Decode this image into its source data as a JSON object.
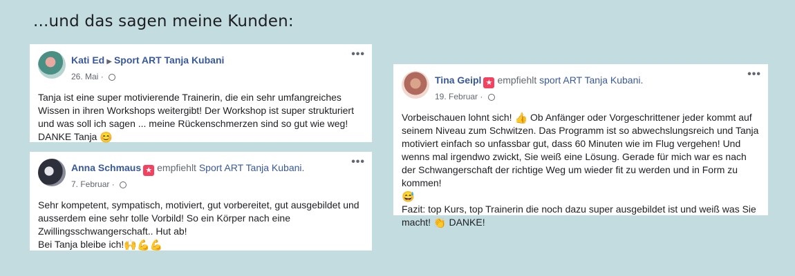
{
  "heading": "...und das sagen meine Kunden:",
  "reviews": [
    {
      "author": "Kati Ed",
      "arrow": "▶",
      "page": "Sport ART Tanja Kubani",
      "date": "26. Mai",
      "more": "•••",
      "text": "Tanja ist eine super motivierende Trainerin, die ein sehr umfangreiches Wissen in ihren Workshops weitergibt! Der Workshop ist super strukturiert und was soll ich sagen ... meine Rückenschmerzen sind so gut wie weg! DANKE Tanja",
      "emoji": "😊"
    },
    {
      "author": "Anna Schmaus",
      "badge_label": "empfiehlt",
      "page": "Sport ART Tanja Kubani.",
      "date": "7. Februar",
      "more": "•••",
      "text_lines": [
        "Sehr kompetent, sympatisch, motiviert, gut vorbereitet, gut ausgebildet und ausserdem eine sehr tolle Vorbild! So ein Körper nach eine Zwillingsschwangerschaft.. Hut ab!",
        "Bei Tanja bleibe ich!"
      ],
      "emojis": [
        "🙌",
        "💪",
        "💪"
      ]
    },
    {
      "author": "Tina Geipl",
      "badge_label": "empfiehlt",
      "page": "sport ART Tanja Kubani.",
      "date": "19. Februar",
      "more": "•••",
      "text_part1": "Vorbeischauen lohnt sich!",
      "emoji1": "👍",
      "text_part2": "Ob Anfänger oder Vorgeschrittener jeder kommt auf seinem Niveau zum Schwitzen. Das Programm ist so abwechslungsreich und Tanja motiviert einfach so unfassbar gut, dass 60 Minuten wie im Flug vergehen! Und wenns mal irgendwo zwickt, Sie weiß eine Lösung. Gerade für mich war es nach der Schwangerschaft der richtige Weg um wieder fit zu werden und in Form zu kommen!",
      "emoji2": "😅",
      "text_part3": "Fazit: top Kurs, top Trainerin die noch dazu super ausgebildet ist und weiß was Sie macht!",
      "emoji3": "👏",
      "text_part4": "DANKE!"
    }
  ]
}
